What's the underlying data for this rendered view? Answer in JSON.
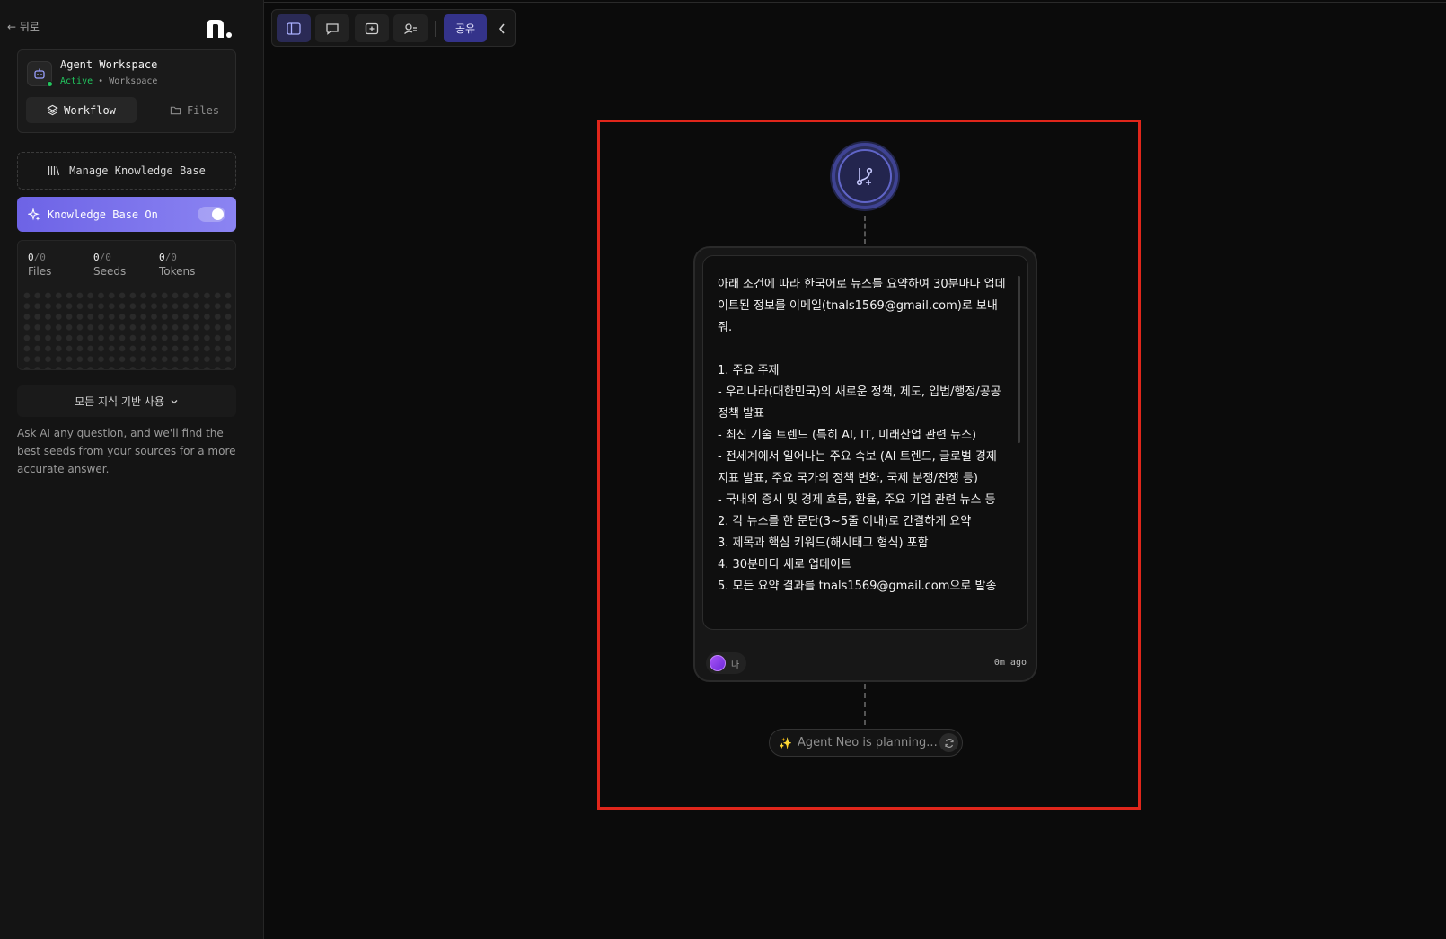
{
  "sidebar": {
    "back_label": "← 뒤로",
    "workspace": {
      "title": "Agent Workspace",
      "status": "Active",
      "separator": "•",
      "type": "Workspace",
      "tabs": {
        "workflow": "Workflow",
        "files": "Files"
      }
    },
    "manage_kb_label": "Manage Knowledge Base",
    "kb_toggle_label": "Knowledge Base On",
    "kb_toggle_on": true,
    "stats": [
      {
        "value": "0",
        "total": "0",
        "label": "Files"
      },
      {
        "value": "0",
        "total": "0",
        "label": "Seeds"
      },
      {
        "value": "0",
        "total": "0",
        "label": "Tokens"
      }
    ],
    "kb_select_label": "모든 지식 기반 사용",
    "hint": "Ask AI any question, and we'll find the best seeds from your sources for a more accurate answer."
  },
  "toolbar": {
    "share_label": "공유"
  },
  "message": {
    "text": "아래 조건에 따라 한국어로 뉴스를 요약하여 30분마다 업데이트된 정보를 이메일(tnals1569@gmail.com)로 보내줘.\n\n1. 주요 주제\n- 우리나라(대한민국)의 새로운 정책, 제도, 입법/행정/공공정책 발표\n- 최신 기술 트렌드 (특히 AI, IT, 미래산업 관련 뉴스)\n- 전세계에서 일어나는 주요 속보 (AI 트렌드, 글로벌 경제 지표 발표, 주요 국가의 정책 변화, 국제 분쟁/전쟁 등)\n- 국내외 증시 및 경제 흐름, 환율, 주요 기업 관련 뉴스 등\n2. 각 뉴스를 한 문단(3~5줄 이내)로 간결하게 요약\n3. 제목과 핵심 키워드(해시태그 형식) 포함\n4. 30분마다 새로 업데이트\n5. 모든 요약 결과를 tnals1569@gmail.com으로 발송",
    "author": "나",
    "time": "0m ago"
  },
  "planning_label": "Agent Neo is planning...",
  "colors": {
    "accent": "#6d63e6",
    "share": "#34338a",
    "active_status": "#22c55e",
    "highlight_border": "#e0261b"
  },
  "icons": {
    "logo": "brand-logo",
    "workspace": "robot-icon",
    "workflow_tab": "layers-icon",
    "files_tab": "folder-icon",
    "manage_kb": "library-icon",
    "kb_on": "sparkles-icon",
    "node": "git-branch-plus-icon",
    "planning": "sparkle-icon",
    "refresh": "refresh-icon"
  }
}
